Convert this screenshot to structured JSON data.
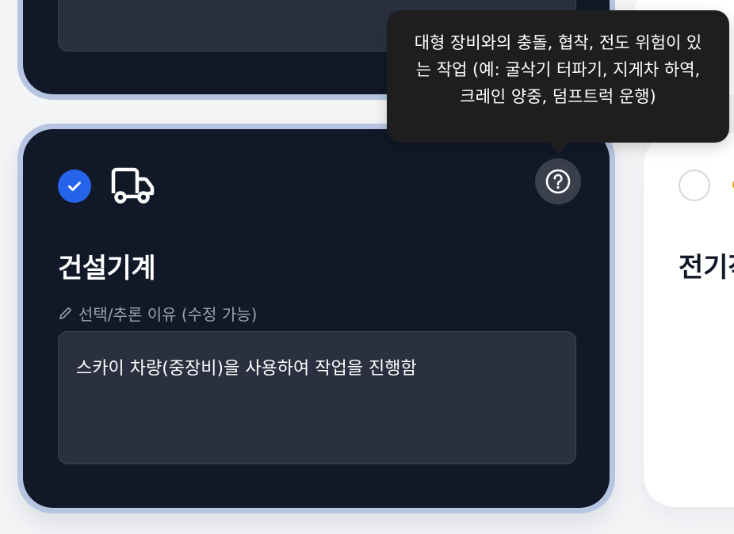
{
  "main_card": {
    "title": "건설기계",
    "reason_label": "선택/추론 이유 (수정 가능)",
    "reason_value": "스카이 차량(중장비)을 사용하여 작업을 진행함",
    "selected": true,
    "icon": "truck-icon"
  },
  "tooltip": {
    "text": "대형 장비와의 충돌, 협착, 전도 위험이 있는 작업 (예: 굴삭기 터파기, 지게차 하역, 크레인 양중, 덤프트럭 운행)"
  },
  "right_card": {
    "title": "전기작"
  },
  "colors": {
    "card_bg": "#111827",
    "card_border": "#b6c6e2",
    "accent": "#2563eb",
    "tooltip_bg": "#1e1e1e"
  }
}
